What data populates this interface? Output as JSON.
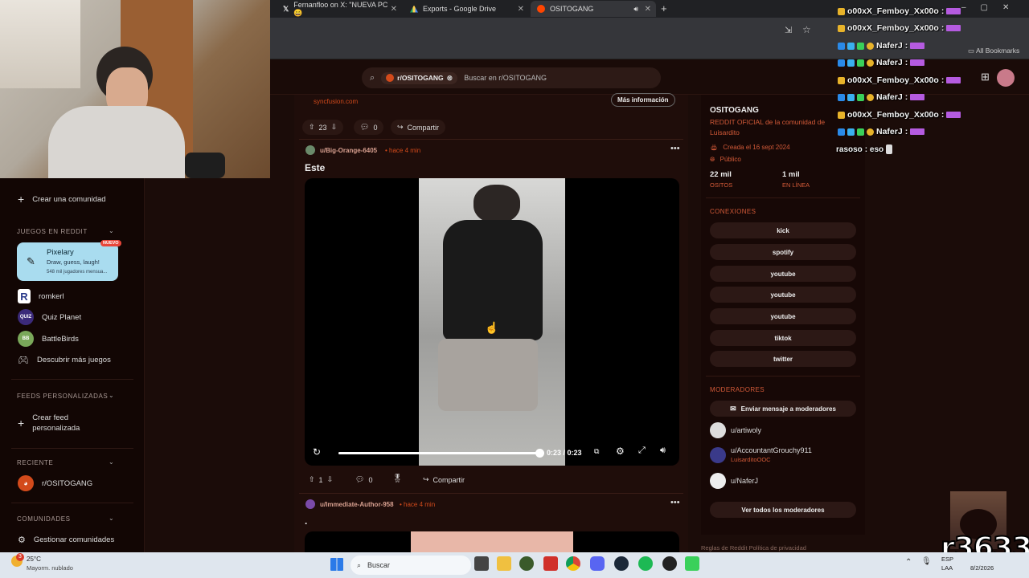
{
  "tabs": [
    {
      "icon": "X",
      "label": "Fernanfloo on X: \"NUEVA PC 😄"
    },
    {
      "icon": "drive",
      "label": "Exports - Google Drive"
    },
    {
      "icon": "reddit",
      "label": "OSITOGANG"
    }
  ],
  "bookmarks": {
    "all_label": "All Bookmarks"
  },
  "search": {
    "chip": "r/OSITOGANG",
    "placeholder": "Buscar en r/OSITOGANG"
  },
  "ad": {
    "domain": "syncfusion.com",
    "cta": "Más información",
    "votes": "23",
    "comments": "0",
    "share": "Compartir"
  },
  "post1": {
    "author": "u/Big-Orange-6405",
    "time": "• hace 4 min",
    "title": "Este",
    "time_played": "0:23 / 0:23",
    "votes": "1",
    "comments": "0",
    "share": "Compartir",
    "progress": 1.0
  },
  "post2": {
    "author": "u/Immediate-Author-958",
    "time": "• hace 4 min",
    "title": "."
  },
  "sidebar": {
    "create_community": "Crear una comunidad",
    "games_header": "JUEGOS EN REDDIT",
    "featured_game": {
      "title": "Pixelary",
      "desc": "Draw, guess, laugh!",
      "meta": "548 mil jugadores mensua...",
      "badge": "NUEVO"
    },
    "games": [
      {
        "label": "romkerl",
        "icon_text": "R"
      },
      {
        "label": "Quiz Planet",
        "icon_text": "QUIZ"
      },
      {
        "label": "BattleBirds",
        "icon_text": "BB"
      }
    ],
    "discover": "Descubrir más juegos",
    "feeds_header": "FEEDS PERSONALIZADAS",
    "create_feed": "Crear feed personalizada",
    "recent_header": "RECIENTE",
    "recent_item": "r/OSITOGANG",
    "communities_header": "COMUNIDADES",
    "manage": "Gestionar comunidades"
  },
  "community": {
    "name": "OSITOGANG",
    "desc": "REDDIT OFICIAL de la comunidad de Luisardito",
    "created": "Creada el 16 sept 2024",
    "visibility": "Público",
    "members_value": "22 mil",
    "members_label": "OSITOS",
    "online_value": "1 mil",
    "online_label": "EN LÍNEA",
    "connections_header": "CONEXIONES",
    "connections": [
      "kick",
      "spotify",
      "youtube",
      "youtube",
      "youtube",
      "tiktok",
      "twitter"
    ],
    "moderators_header": "MODERADORES",
    "message_mods": "Enviar mensaje a moderadores",
    "mods": [
      {
        "name": "u/artiwoly",
        "flair": ""
      },
      {
        "name": "u/AccountantGrouchy911",
        "flair": "LuisarditoOOC"
      },
      {
        "name": "u/NaferJ",
        "flair": ""
      }
    ],
    "view_all_mods": "Ver todos los moderadores",
    "footer": "Reglas de Reddit   Política de privacidad"
  },
  "chat": [
    {
      "user": "o00xX_Femboy_Xx00o",
      "sep": ":",
      "badges": "crown"
    },
    {
      "user": "o00xX_Femboy_Xx00o",
      "sep": ":",
      "badges": "crown"
    },
    {
      "user": "NaferJ",
      "sep": ":",
      "badges": "mod"
    },
    {
      "user": "NaferJ",
      "sep": ":",
      "badges": "mod"
    },
    {
      "user": "o00xX_Femboy_Xx00o",
      "sep": ":",
      "badges": "crown"
    },
    {
      "user": "NaferJ",
      "sep": ":",
      "badges": "mod"
    },
    {
      "user": "o00xX_Femboy_Xx00o",
      "sep": ":",
      "badges": "crown"
    },
    {
      "user": "NaferJ",
      "sep": ":",
      "badges": "mod"
    },
    {
      "user": "rasoso",
      "sep": ": eso",
      "badges": "none"
    }
  ],
  "overlay_text": "r3633",
  "taskbar": {
    "weather_temp": "25°C",
    "weather_desc": "Mayorm. nublado",
    "search": "Buscar",
    "lang1": "ESP",
    "lang2": "LAA",
    "date": "8/2/2026",
    "notif_count": "3"
  },
  "colors": {
    "accent": "#d93a00",
    "brand_orange": "#ff4500",
    "bg": "#1b0c09",
    "chat_emote": "#b55be0"
  }
}
